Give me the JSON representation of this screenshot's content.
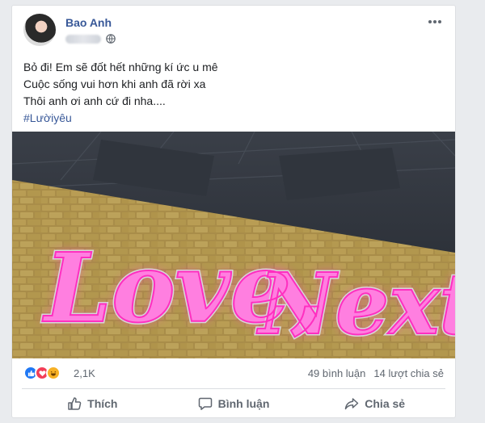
{
  "post": {
    "author": "Bao Anh",
    "lines": [
      "Bỏ đi! Em sẽ đốt hết những kí ức u mê",
      "Cuộc sống vui hơn khi anh đã rời xa",
      "Thôi anh ơi anh cứ đi nha...."
    ],
    "hashtag": "#Lườiyêu",
    "privacy_icon": "globe-icon"
  },
  "photo": {
    "sign_text": "Love, Next!",
    "sign_color": "#ff2fc0"
  },
  "stats": {
    "reactions": [
      "like",
      "love",
      "haha"
    ],
    "reaction_count": "2,1K",
    "comments": "49 bình luận",
    "shares": "14 lượt chia sẻ"
  },
  "actions": {
    "like": "Thích",
    "comment": "Bình luận",
    "share": "Chia sẻ"
  },
  "colors": {
    "link_blue": "#385898",
    "like_blue": "#2078f4",
    "love_red": "#f33e58",
    "haha_yellow": "#f7b125"
  }
}
